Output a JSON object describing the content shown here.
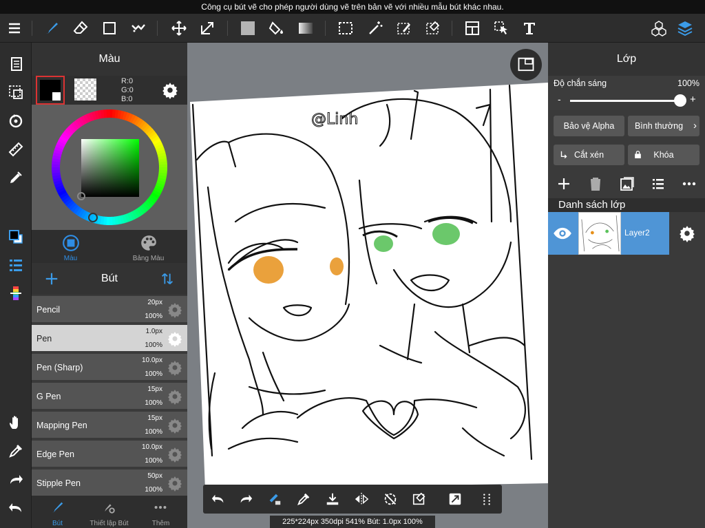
{
  "hint": "Công cụ bút vẽ cho phép người dùng vẽ trên bản vẽ với nhiều mẫu bút khác nhau.",
  "color_panel": {
    "title": "Màu",
    "rgb": {
      "r": "R:0",
      "g": "G:0",
      "b": "B:0"
    },
    "tabs": [
      {
        "label": "Màu"
      },
      {
        "label": "Bảng Màu"
      }
    ],
    "colors": {
      "active_tab": "#2f8de4",
      "wheel_bg": "#5e5e5e"
    }
  },
  "brush_panel": {
    "title": "Bút",
    "brushes": [
      {
        "name": "Pencil",
        "size": "20px",
        "opacity": "100%"
      },
      {
        "name": "Pen",
        "size": "1.0px",
        "opacity": "100%"
      },
      {
        "name": "Pen (Sharp)",
        "size": "10.0px",
        "opacity": "100%"
      },
      {
        "name": "G Pen",
        "size": "15px",
        "opacity": "100%"
      },
      {
        "name": "Mapping Pen",
        "size": "15px",
        "opacity": "100%"
      },
      {
        "name": "Edge Pen",
        "size": "10.0px",
        "opacity": "100%"
      },
      {
        "name": "Stipple Pen",
        "size": "50px",
        "opacity": "100%"
      }
    ],
    "tabs": [
      {
        "label": "Bút"
      },
      {
        "label": "Thiết lập Bút"
      },
      {
        "label": "Thêm"
      }
    ]
  },
  "layer_panel": {
    "title": "Lớp",
    "opacity_label": "Độ chắn sáng",
    "opacity_value": "100%",
    "slider_fraction": 1.0,
    "minus": "-",
    "plus": "+",
    "protect_alpha": "Bảo vệ Alpha",
    "blend_mode": "Bình thường",
    "clip": "Cắt xén",
    "lock": "Khóa",
    "list_title": "Danh sách lớp",
    "layers": [
      {
        "name": "Layer2"
      }
    ],
    "colors": {
      "selected_layer": "#4f95d6"
    }
  },
  "status": "225*224px 350dpi 541% Bút: 1.0px 100%",
  "canvas": {
    "signature": "@Linh"
  }
}
